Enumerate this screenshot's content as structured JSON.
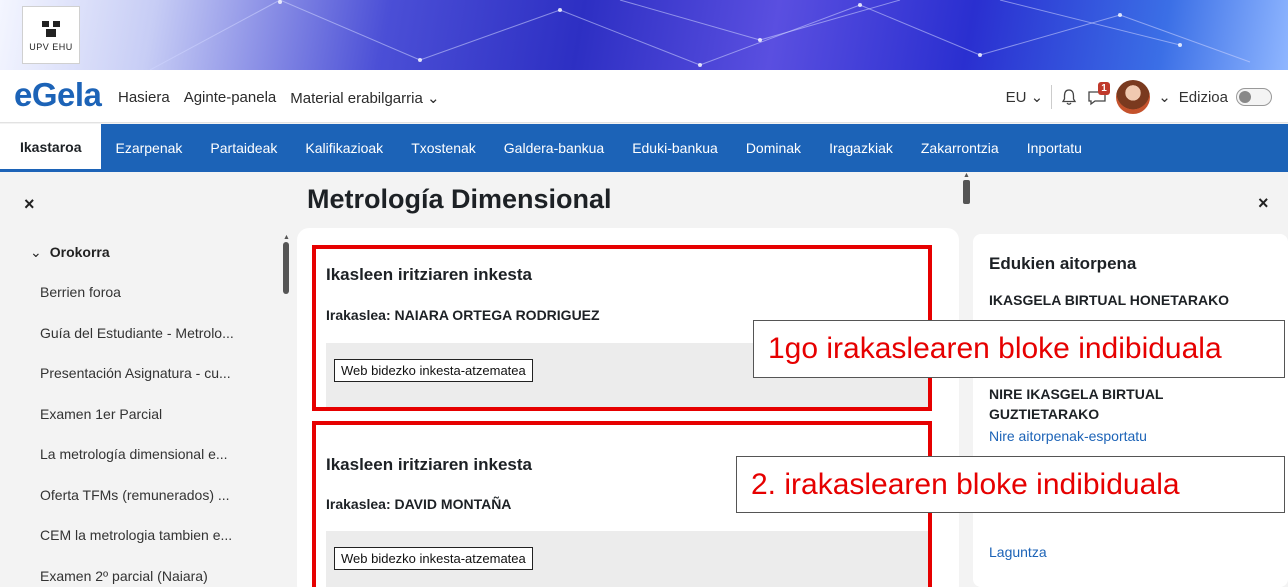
{
  "header": {
    "logo_text": "UPV  EHU",
    "brand": "eGela",
    "nav": [
      "Hasiera",
      "Aginte-panela",
      "Material erabilgarria ⌄"
    ],
    "language": "EU ⌄",
    "notification_count": "1",
    "user_menu_chevron": "⌄",
    "edit_label": "Edizioa"
  },
  "course_nav": {
    "items": [
      "Ikastaroa",
      "Ezarpenak",
      "Partaideak",
      "Kalifikazioak",
      "Txostenak",
      "Galdera-bankua",
      "Eduki-bankua",
      "Dominak",
      "Iragazkiak",
      "Zakarrontzia",
      "Inportatu"
    ],
    "active": "Ikastaroa"
  },
  "left_drawer": {
    "close": "×",
    "section_chevron": "⌄",
    "section": "Orokorra",
    "items": [
      "Berrien foroa",
      "Guía del Estudiante - Metrolo...",
      "Presentación Asignatura - cu...",
      "Examen 1er Parcial",
      "La metrología dimensional e...",
      "Oferta TFMs (remunerados) ...",
      "CEM la metrologia tambien e...",
      "Examen 2º parcial (Naiara)"
    ]
  },
  "main": {
    "title": "Metrología Dimensional",
    "blocks": [
      {
        "heading": "Ikasleen iritziaren inkesta",
        "teacher": "Irakaslea: NAIARA ORTEGA RODRIGUEZ",
        "button": "Web bidezko inkesta-atzematea"
      },
      {
        "heading": "Ikasleen iritziaren inkesta",
        "teacher": "Irakaslea: DAVID                MONTAÑA",
        "button": "Web bidezko inkesta-atzematea"
      }
    ]
  },
  "right_drawer": {
    "close": "×",
    "title": "Edukien aitorpena",
    "section1": "IKASGELA BIRTUAL HONETARAKO",
    "section2": "NIRE IKASGELA BIRTUAL GUZTIETARAKO",
    "export_link": "Nire aitorpenak-esportatu",
    "help_link": "Laguntza"
  },
  "callouts": {
    "first": "1go irakaslearen bloke indibiduala",
    "second": "2. irakaslearen bloke indibiduala"
  },
  "colors": {
    "brand": "#1c63b7",
    "highlight": "#e60000",
    "badge": "#c0392b"
  }
}
